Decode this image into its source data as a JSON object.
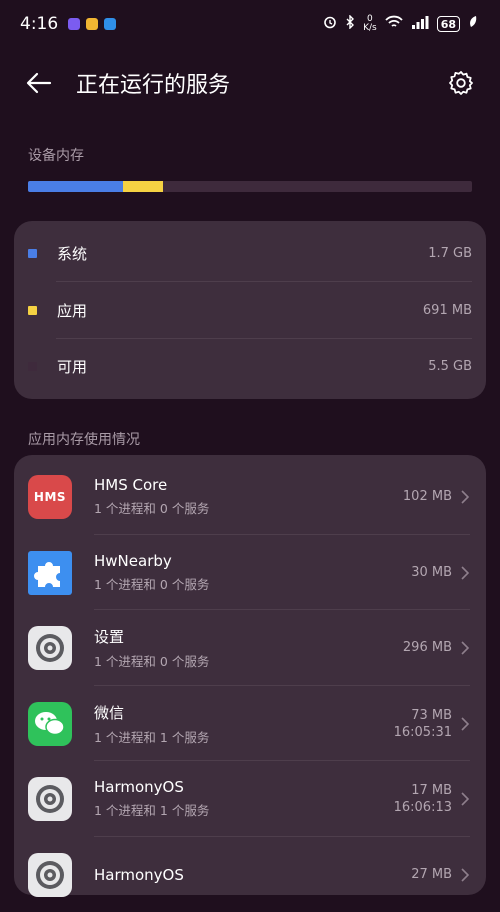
{
  "status_bar": {
    "time": "4:16",
    "net_speed_value": "0",
    "net_speed_unit": "K/s",
    "battery": "68"
  },
  "header": {
    "title": "正在运行的服务"
  },
  "memory": {
    "section_label": "设备内存",
    "usage_fractions": {
      "system": 0.215,
      "apps": 0.088,
      "free": 0.697
    },
    "legend": [
      {
        "name": "系统",
        "value": "1.7 GB",
        "color": "#4a7ee6"
      },
      {
        "name": "应用",
        "value": "691 MB",
        "color": "#f5d243"
      },
      {
        "name": "可用",
        "value": "5.5 GB",
        "color": "#3e2a3c"
      }
    ]
  },
  "apps_section": {
    "label": "应用内存使用情况",
    "apps": [
      {
        "name": "HMS Core",
        "detail": "1 个进程和 0 个服务",
        "size": "102 MB",
        "time": "",
        "icon": "hms-core-icon",
        "icon_text": "HMS"
      },
      {
        "name": "HwNearby",
        "detail": "1 个进程和 0 个服务",
        "size": "30 MB",
        "time": "",
        "icon": "puzzle-icon",
        "icon_text": ""
      },
      {
        "name": "设置",
        "detail": "1 个进程和 0 个服务",
        "size": "296 MB",
        "time": "",
        "icon": "settings-gear-icon",
        "icon_text": ""
      },
      {
        "name": "微信",
        "detail": "1 个进程和 1 个服务",
        "size": "73 MB",
        "time": "16:05:31",
        "icon": "wechat-icon",
        "icon_text": ""
      },
      {
        "name": "HarmonyOS",
        "detail": "1 个进程和 1 个服务",
        "size": "17 MB",
        "time": "16:06:13",
        "icon": "settings-gear-icon",
        "icon_text": ""
      },
      {
        "name": "HarmonyOS",
        "detail": "",
        "size": "27 MB",
        "time": "",
        "icon": "settings-gear-icon",
        "icon_text": ""
      }
    ]
  }
}
